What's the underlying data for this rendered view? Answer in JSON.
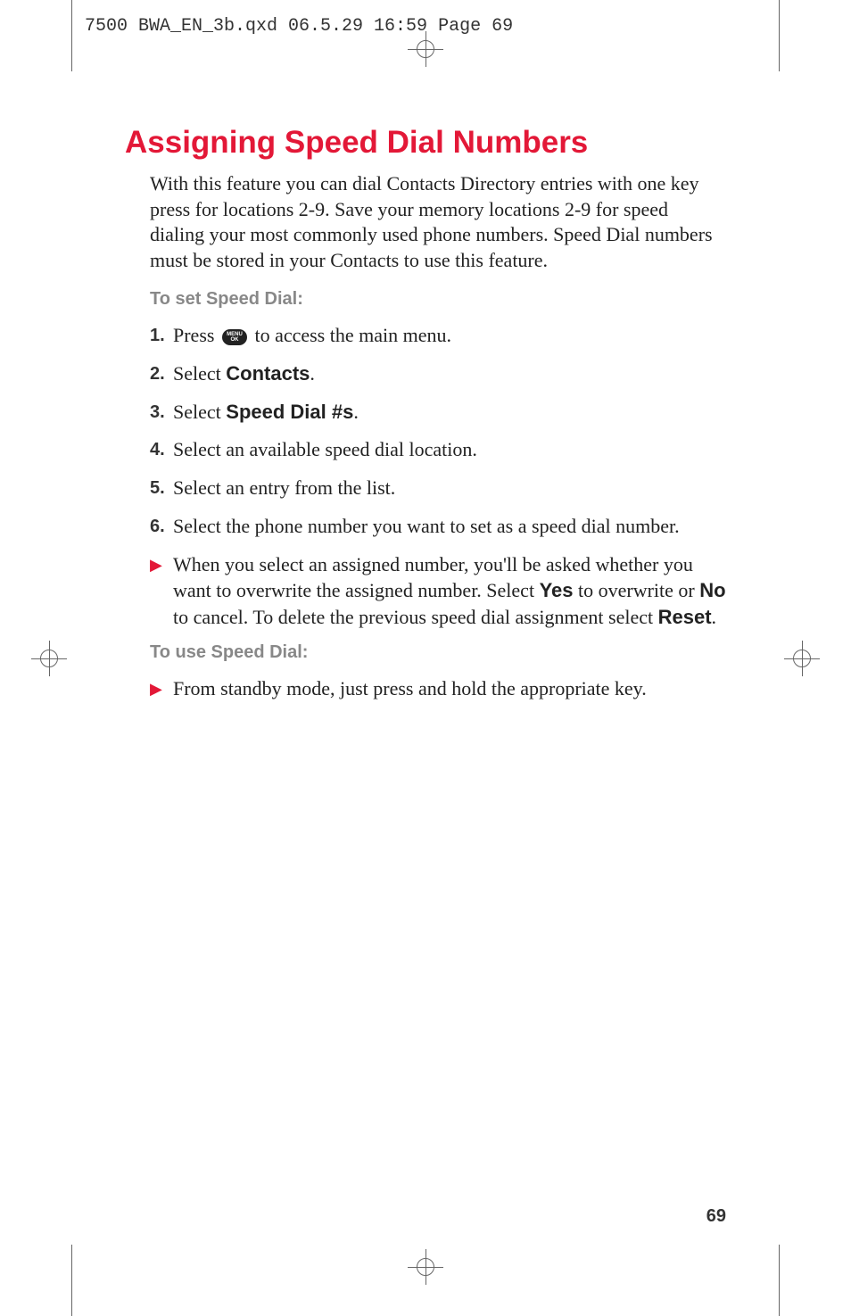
{
  "header": {
    "file_info": "7500 BWA_EN_3b.qxd  06.5.29  16:59  Page 69"
  },
  "title": "Assigning Speed Dial Numbers",
  "intro": "With this feature you can dial Contacts Directory entries with one key press for locations 2-9. Save your memory locations 2-9 for speed dialing your most commonly used phone numbers. Speed Dial numbers must be stored in your Contacts to use this feature.",
  "section_set": {
    "heading": "To set Speed Dial:",
    "steps": [
      {
        "num": "1.",
        "pre": "Press ",
        "icon": "MENU OK",
        "post": " to access the main menu."
      },
      {
        "num": "2.",
        "pre": "Select ",
        "bold": "Contacts",
        "post": "."
      },
      {
        "num": "3.",
        "pre": "Select ",
        "bold": "Speed Dial #s",
        "post": "."
      },
      {
        "num": "4.",
        "text": "Select an available speed dial location."
      },
      {
        "num": "5.",
        "text": "Select an entry from the list."
      },
      {
        "num": "6.",
        "text": "Select the phone number you want to set as a speed dial number."
      }
    ],
    "note": {
      "parts": [
        {
          "text": "When you select an assigned number, you'll be asked whether you want to overwrite the assigned number. Select "
        },
        {
          "bold": "Yes"
        },
        {
          "text": " to overwrite or "
        },
        {
          "bold": "No"
        },
        {
          "text": " to cancel. To delete the previous speed dial assignment select "
        },
        {
          "bold": "Reset"
        },
        {
          "text": "."
        }
      ]
    }
  },
  "section_use": {
    "heading": "To use Speed Dial:",
    "bullet": "From standby mode, just press and hold the appropriate key."
  },
  "page_number": "69"
}
